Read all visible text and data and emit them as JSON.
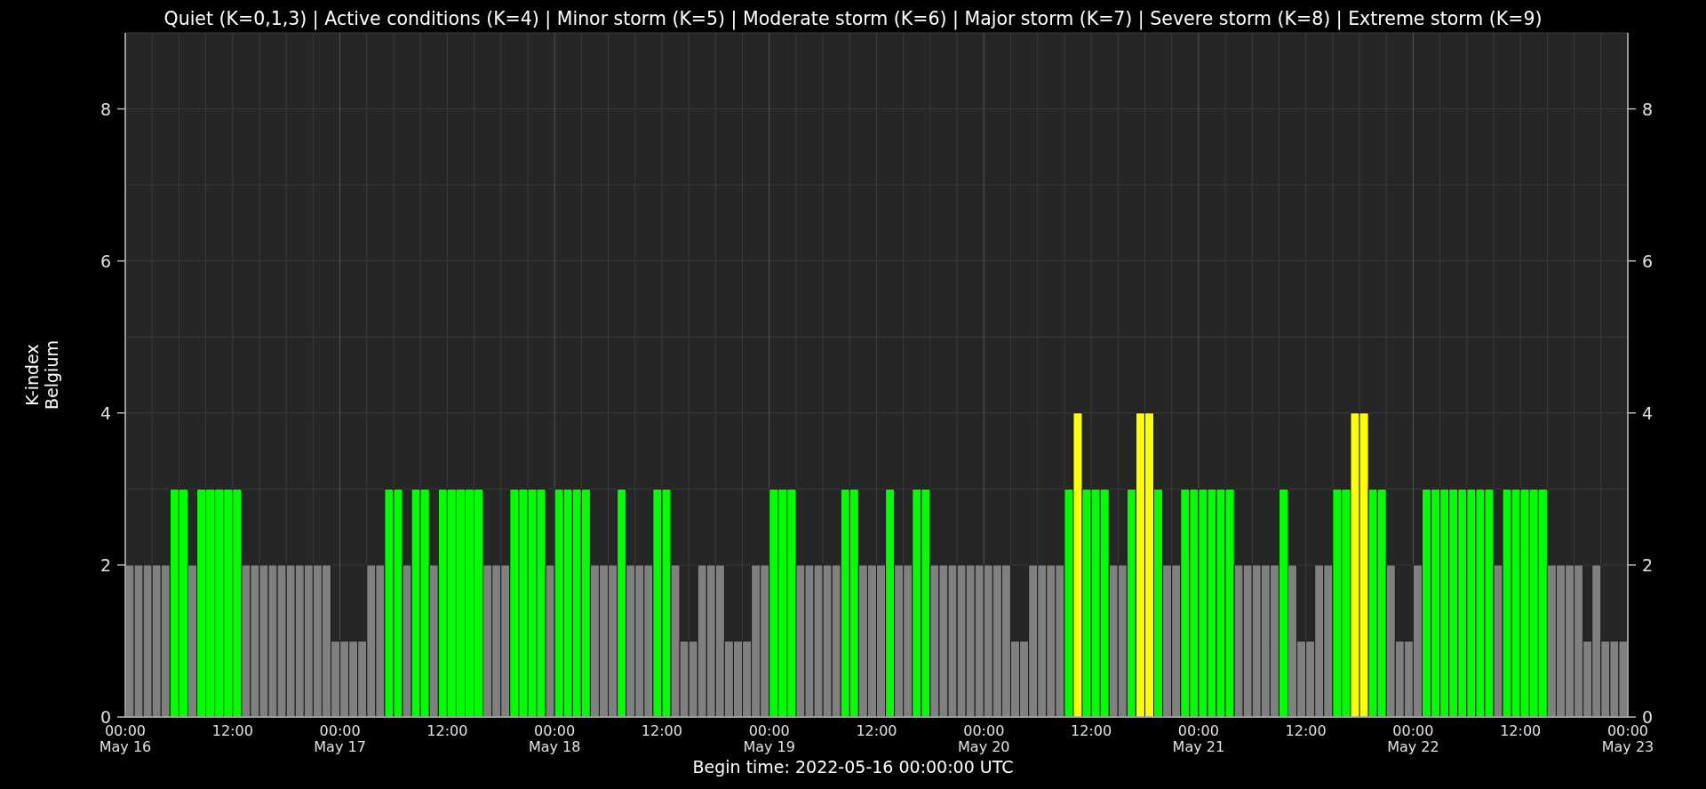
{
  "chart_data": {
    "type": "bar",
    "title": "Quiet (K=0,1,3) | Active conditions (K=4) | Minor storm (K=5) | Moderate storm (K=6) | Major storm (K=7) | Severe storm (K=8) | Extreme storm (K=9)",
    "xlabel": "Begin time: 2022-05-16 00:00:00 UTC",
    "ylabel": "K-index\nBelgium",
    "grid": true,
    "ylim": [
      0,
      9
    ],
    "categories": [
      "00:00\nMay 16",
      null,
      null,
      null,
      null,
      null,
      null,
      null,
      null,
      null,
      null,
      null,
      "12:00",
      null,
      null,
      null,
      null,
      null,
      null,
      null,
      null,
      null,
      null,
      null,
      "00:00\nMay 17",
      null,
      null,
      null,
      null,
      null,
      null,
      null,
      null,
      null,
      null,
      null,
      "12:00",
      null,
      null,
      null,
      null,
      null,
      null,
      null,
      null,
      null,
      null,
      null,
      "00:00\nMay 18",
      null,
      null,
      null,
      null,
      null,
      null,
      null,
      null,
      null,
      null,
      null,
      "12:00",
      null,
      null,
      null,
      null,
      null,
      null,
      null,
      null,
      null,
      null,
      null,
      "00:00\nMay 19",
      null,
      null,
      null,
      null,
      null,
      null,
      null,
      null,
      null,
      null,
      null,
      "12:00",
      null,
      null,
      null,
      null,
      null,
      null,
      null,
      null,
      null,
      null,
      null,
      "00:00\nMay 20",
      null,
      null,
      null,
      null,
      null,
      null,
      null,
      null,
      null,
      null,
      null,
      "12:00",
      null,
      null,
      null,
      null,
      null,
      null,
      null,
      null,
      null,
      null,
      null,
      "00:00\nMay 21",
      null,
      null,
      null,
      null,
      null,
      null,
      null,
      null,
      null,
      null,
      null,
      "12:00",
      null,
      null,
      null,
      null,
      null,
      null,
      null,
      null,
      null,
      null,
      null,
      "00:00\nMay 22",
      null,
      null,
      null,
      null,
      null,
      null,
      null,
      null,
      null,
      null,
      null,
      "12:00",
      null,
      null,
      null,
      null,
      null,
      null,
      null,
      null,
      null,
      null,
      null
    ],
    "yticks": [
      0,
      2,
      4,
      6,
      8
    ],
    "annotations": [
      "0",
      "2",
      "4",
      "6",
      "8",
      "00:00\nMay 23"
    ],
    "series": [
      {
        "values": [
          2,
          2,
          2,
          2,
          2,
          3,
          3,
          2,
          3,
          3,
          3,
          3,
          3,
          2,
          2,
          2,
          2,
          2,
          2,
          2,
          2,
          2,
          2,
          1,
          1,
          1,
          1,
          2,
          2,
          3,
          3,
          2,
          3,
          3,
          2,
          3,
          3,
          3,
          3,
          3,
          2,
          2,
          2,
          3,
          3,
          3,
          3,
          2,
          3,
          3,
          3,
          3,
          2,
          2,
          2,
          3,
          2,
          2,
          2,
          3,
          3,
          2,
          1,
          1,
          2,
          2,
          2,
          1,
          1,
          1,
          2,
          2,
          3,
          3,
          3,
          2,
          2,
          2,
          2,
          2,
          3,
          3,
          2,
          2,
          2,
          3,
          2,
          2,
          3,
          3,
          2,
          2,
          2,
          2,
          2,
          2,
          2,
          2,
          2,
          1,
          1,
          2,
          2,
          2,
          2,
          3,
          4,
          3,
          3,
          3,
          2,
          2,
          3,
          4,
          4,
          3,
          2,
          2,
          3,
          3,
          3,
          3,
          3,
          3,
          2,
          2,
          2,
          2,
          2,
          3,
          2,
          1,
          1,
          2,
          2,
          3,
          3,
          4,
          4,
          3,
          3,
          2,
          1,
          1,
          2,
          3,
          3,
          3,
          3,
          3,
          3,
          3,
          3,
          2,
          3,
          3,
          3,
          3,
          3,
          2,
          2,
          2,
          2,
          1,
          2,
          1,
          1,
          1
        ]
      }
    ]
  }
}
